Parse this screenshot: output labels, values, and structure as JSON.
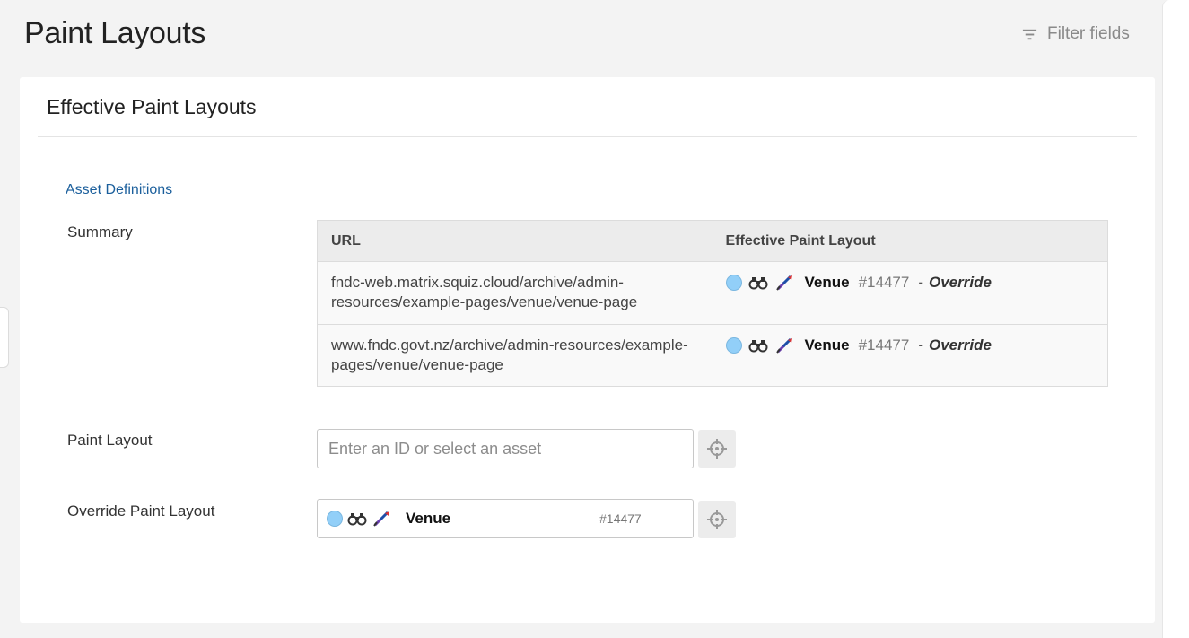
{
  "page": {
    "title": "Paint Layouts",
    "filter_label": "Filter fields"
  },
  "panel": {
    "title": "Effective Paint Layouts",
    "section_link": "Asset Definitions"
  },
  "summary": {
    "label": "Summary",
    "columns": [
      "URL",
      "Effective Paint Layout"
    ],
    "rows": [
      {
        "url": "fndc-web.matrix.squiz.cloud/archive/admin-resources/example-pages/venue/venue-page",
        "layout_name": "Venue",
        "layout_id": "#14477",
        "dash": "-",
        "mode": "Override"
      },
      {
        "url": "www.fndc.govt.nz/archive/admin-resources/example-pages/venue/venue-page",
        "layout_name": "Venue",
        "layout_id": "#14477",
        "dash": "-",
        "mode": "Override"
      }
    ]
  },
  "paint_layout": {
    "label": "Paint Layout",
    "placeholder": "Enter an ID or select an asset",
    "value": ""
  },
  "override_paint_layout": {
    "label": "Override Paint Layout",
    "asset_name": "Venue",
    "asset_id": "#14477"
  },
  "icons": {
    "status": "status-dot-icon",
    "preview": "binoculars-icon",
    "paint_layout": "paint-layout-icon",
    "picker": "crosshair-icon",
    "filter": "filter-icon"
  },
  "colors": {
    "link": "#1b5f9c",
    "status_dot": "#92cff8",
    "background": "#f3f3f3"
  }
}
